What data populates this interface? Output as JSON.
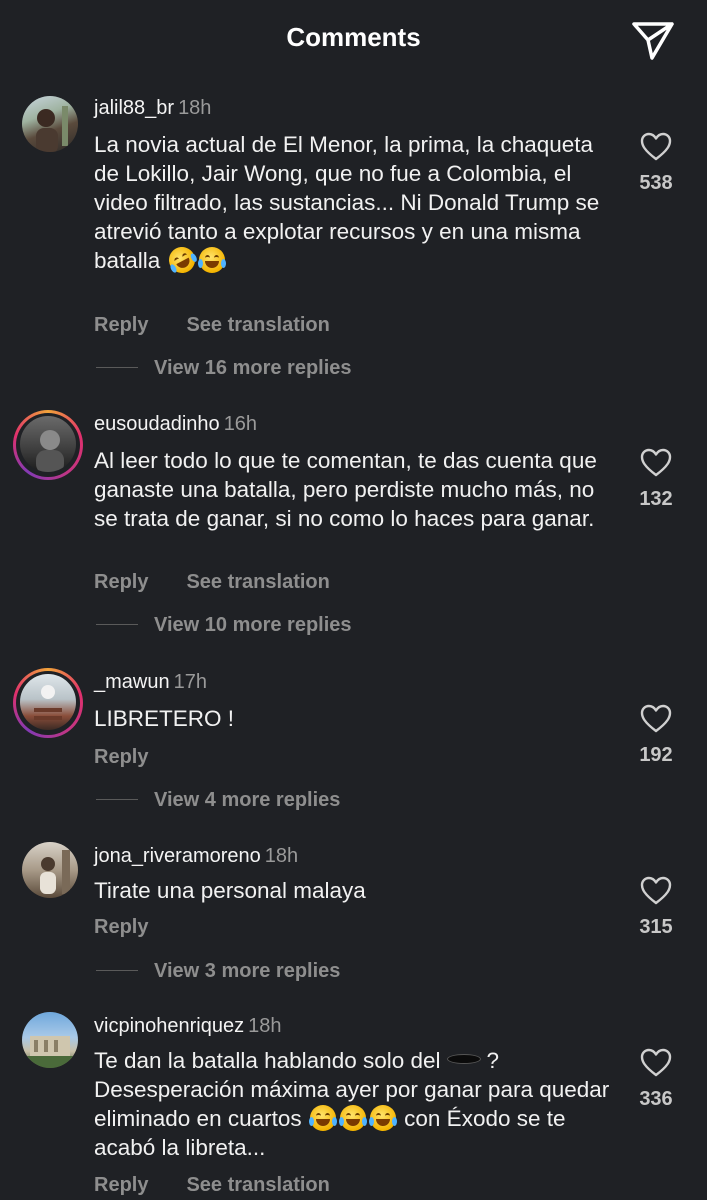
{
  "header": {
    "title": "Comments"
  },
  "actions": {
    "reply": "Reply",
    "see_translation": "See translation"
  },
  "comments": [
    {
      "username": "jalil88_br",
      "time": "18h",
      "text": "La novia actual de El Menor, la prima, la chaqueta de Lokillo, Jair Wong, que no fue a Colombia, el video filtrado, las sustancias... Ni Donald Trump se atrevió tanto a explotar recursos y en una misma batalla",
      "emojis": [
        "rolling-on-floor-laughing",
        "face-with-tears-of-joy"
      ],
      "likes": "538",
      "view_replies": "View 16 more replies",
      "has_story_ring": false
    },
    {
      "username": "eusoudadinho",
      "time": "16h",
      "text": "Al leer todo lo que te comentan, te das cuenta que ganaste una batalla, pero perdiste mucho más, no se trata de ganar, si no como lo haces para ganar.",
      "likes": "132",
      "view_replies": "View 10 more replies",
      "has_story_ring": true
    },
    {
      "username": "_mawun",
      "time": "17h",
      "text": "LIBRETERO !",
      "likes": "192",
      "view_replies": "View 4 more replies",
      "has_story_ring": true
    },
    {
      "username": "jona_riveramoreno",
      "time": "18h",
      "text": "Tirate una personal malaya",
      "likes": "315",
      "view_replies": "View 3 more replies",
      "has_story_ring": false
    },
    {
      "username": "vicpinohenriquez",
      "time": "18h",
      "text_before_hole": "Te dan la batalla hablando solo del",
      "text_after_hole": "? Desesperación máxima ayer por ganar para quedar eliminado en cuartos",
      "text_end": "con Éxodo se te acabó la libreta...",
      "emojis": [
        "hole",
        "face-with-tears-of-joy",
        "face-with-tears-of-joy",
        "face-with-tears-of-joy"
      ],
      "likes": "336",
      "has_story_ring": false
    }
  ],
  "colors": {
    "background": "#1f2125",
    "muted": "#8e8e8e",
    "story_ring": "#e1306c"
  },
  "icons": {
    "share": "paper-plane-icon",
    "like": "heart-outline-icon"
  }
}
